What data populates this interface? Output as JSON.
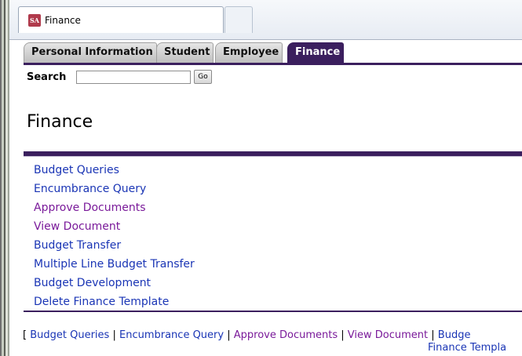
{
  "browser": {
    "tab_title": "Finance",
    "favicon_text": "SA"
  },
  "nav_tabs": [
    {
      "label": "Personal Information",
      "active": false
    },
    {
      "label": "Student",
      "active": false
    },
    {
      "label": "Employee",
      "active": false
    },
    {
      "label": "Finance",
      "active": true
    }
  ],
  "search": {
    "label": "Search",
    "value": "",
    "button_label": "Go"
  },
  "page_title": "Finance",
  "menu_items": [
    {
      "label": "Budget Queries",
      "visited": false
    },
    {
      "label": "Encumbrance Query",
      "visited": false
    },
    {
      "label": "Approve Documents",
      "visited": true
    },
    {
      "label": "View Document",
      "visited": true
    },
    {
      "label": "Budget Transfer",
      "visited": false
    },
    {
      "label": "Multiple Line Budget Transfer",
      "visited": false
    },
    {
      "label": "Budget Development",
      "visited": false
    },
    {
      "label": "Delete Finance Template",
      "visited": false
    }
  ],
  "footer_nav": {
    "open_bracket": "[",
    "separator": "|",
    "links": [
      {
        "label": "Budget Queries",
        "visited": false
      },
      {
        "label": "Encumbrance Query",
        "visited": false
      },
      {
        "label": "Approve Documents",
        "visited": true
      },
      {
        "label": "View Document",
        "visited": true
      },
      {
        "label": "Budge",
        "visited": false
      }
    ],
    "line2_link": "Finance Templa"
  },
  "colors": {
    "accent": "#3b1f5e",
    "link": "#1a35b5",
    "visited_link": "#7a1a9a"
  }
}
